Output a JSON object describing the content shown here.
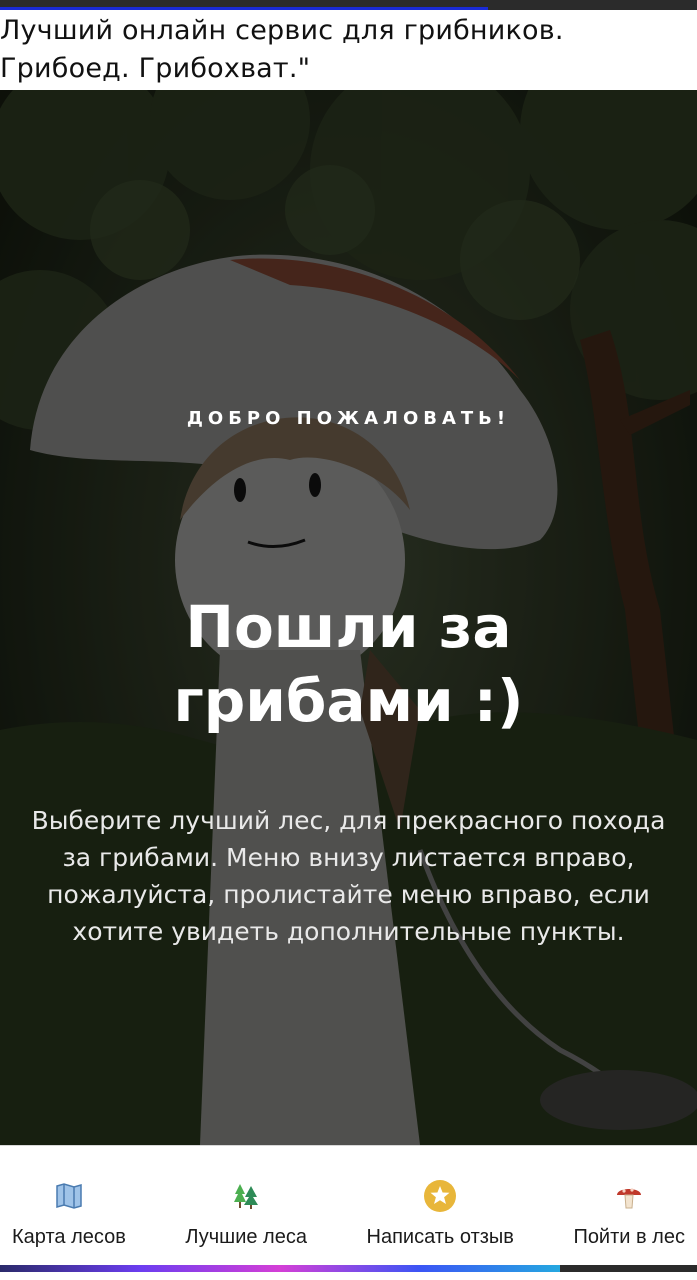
{
  "header": {
    "line1": "Лучший онлайн сервис для грибников.",
    "line2": "Грибоед. Грибохват.\""
  },
  "hero": {
    "welcome": "ДОБРО ПОЖАЛОВАТЬ!",
    "headline_line1": "Пошли за",
    "headline_line2": "грибами :)",
    "description": "Выберите лучший лес, для прекрасного похода за грибами. Меню внизу листается вправо, пожалуйста, пролистайте меню вправо, если хотите увидеть дополнительные пункты."
  },
  "nav": {
    "items": [
      {
        "label": "Карта лесов",
        "icon": "map-icon"
      },
      {
        "label": "Лучшие леса",
        "icon": "trees-icon"
      },
      {
        "label": "Написать отзыв",
        "icon": "star-icon"
      },
      {
        "label": "Пойти в лес",
        "icon": "mushroom-icon"
      }
    ]
  },
  "colors": {
    "progress": "#1a2bd6",
    "hero_bg": "#1f2616",
    "text_light": "#ffffff"
  },
  "top_progress_percent": 70
}
